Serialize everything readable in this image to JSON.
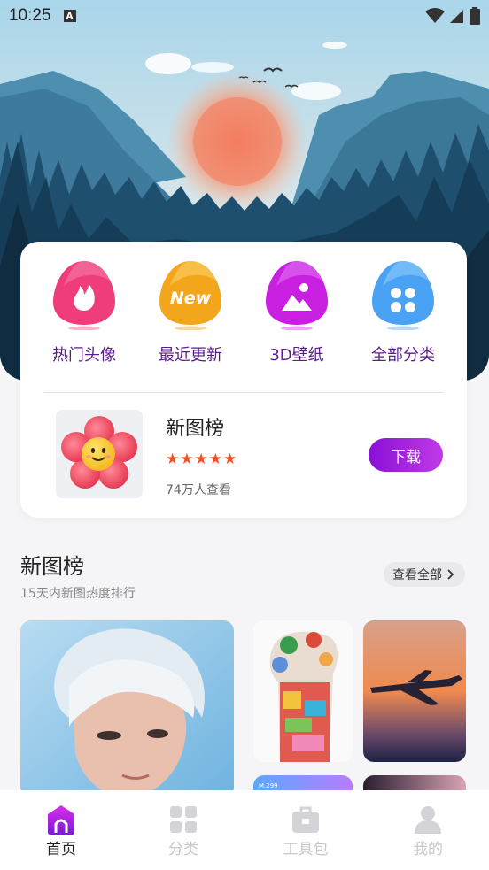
{
  "status_bar": {
    "time": "10:25",
    "notification_badge": "A"
  },
  "categories": [
    {
      "label": "热门头像",
      "icon": "fire-icon",
      "color": "#ef3d7c"
    },
    {
      "label": "最近更新",
      "icon": "new-badge-icon",
      "color": "#f3a51c",
      "badge_text": "New"
    },
    {
      "label": "3D壁纸",
      "icon": "image-icon",
      "color": "#c81fe0"
    },
    {
      "label": "全部分类",
      "icon": "grid-dots-icon",
      "color": "#4aa2f5"
    }
  ],
  "featured": {
    "title": "新图榜",
    "rating": 5,
    "stars": [
      "★",
      "★",
      "★",
      "★",
      "★"
    ],
    "views": "74万人查看",
    "download_label": "下载"
  },
  "section": {
    "title": "新图榜",
    "subtitle": "15天内新图热度排行",
    "view_all_label": "查看全部"
  },
  "nav": [
    {
      "label": "首页",
      "icon": "home-icon",
      "active": true
    },
    {
      "label": "分类",
      "icon": "category-icon",
      "active": false
    },
    {
      "label": "工具包",
      "icon": "toolbox-icon",
      "active": false
    },
    {
      "label": "我的",
      "icon": "profile-icon",
      "active": false
    }
  ]
}
